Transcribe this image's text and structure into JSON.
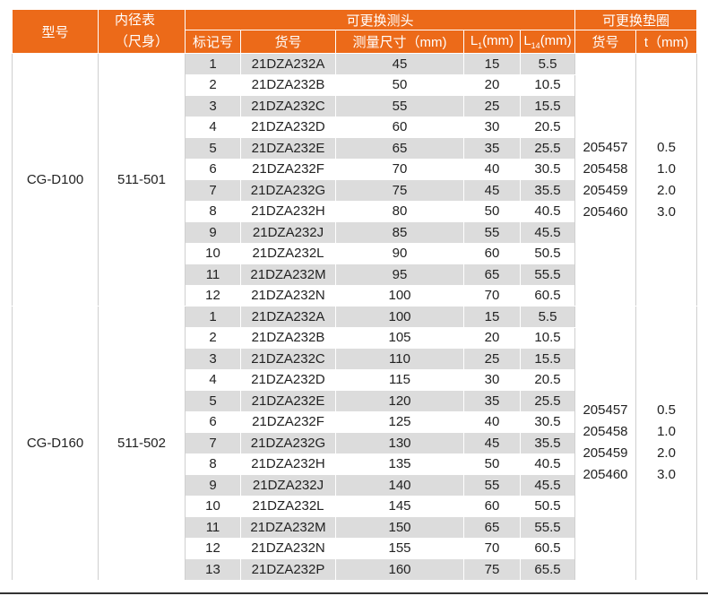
{
  "header": {
    "model": "型号",
    "bore_gauge": "内径表",
    "bore_gauge_sub": "（尺身）",
    "probe_group": "可更换测头",
    "washer_group": "可更换垫圈",
    "mark_no": "标记号",
    "part_no": "货号",
    "range": "测量尺寸（mm)",
    "l1_prefix": "L",
    "l1_sub": "1",
    "l1_suffix": "(mm)",
    "l14_prefix": "L",
    "l14_sub": "14",
    "l14_suffix": "(mm)",
    "washer_part_no": "货号",
    "washer_t": "t（mm)"
  },
  "groups": [
    {
      "model": "CG-D100",
      "bore_gauge": "511-501",
      "washer_codes": [
        "205457",
        "205458",
        "205459",
        "205460"
      ],
      "washer_ts": [
        "0.5",
        "1.0",
        "2.0",
        "3.0"
      ],
      "rows": [
        {
          "mark": "1",
          "part": "21DZA232A",
          "range": "45",
          "l1": "15",
          "l14": "5.5"
        },
        {
          "mark": "2",
          "part": "21DZA232B",
          "range": "50",
          "l1": "20",
          "l14": "10.5"
        },
        {
          "mark": "3",
          "part": "21DZA232C",
          "range": "55",
          "l1": "25",
          "l14": "15.5"
        },
        {
          "mark": "4",
          "part": "21DZA232D",
          "range": "60",
          "l1": "30",
          "l14": "20.5"
        },
        {
          "mark": "5",
          "part": "21DZA232E",
          "range": "65",
          "l1": "35",
          "l14": "25.5"
        },
        {
          "mark": "6",
          "part": "21DZA232F",
          "range": "70",
          "l1": "40",
          "l14": "30.5"
        },
        {
          "mark": "7",
          "part": "21DZA232G",
          "range": "75",
          "l1": "45",
          "l14": "35.5"
        },
        {
          "mark": "8",
          "part": "21DZA232H",
          "range": "80",
          "l1": "50",
          "l14": "40.5"
        },
        {
          "mark": "9",
          "part": "21DZA232J",
          "range": "85",
          "l1": "55",
          "l14": "45.5"
        },
        {
          "mark": "10",
          "part": "21DZA232L",
          "range": "90",
          "l1": "60",
          "l14": "50.5"
        },
        {
          "mark": "11",
          "part": "21DZA232M",
          "range": "95",
          "l1": "65",
          "l14": "55.5"
        },
        {
          "mark": "12",
          "part": "21DZA232N",
          "range": "100",
          "l1": "70",
          "l14": "60.5"
        }
      ]
    },
    {
      "model": "CG-D160",
      "bore_gauge": "511-502",
      "washer_codes": [
        "205457",
        "205458",
        "205459",
        "205460"
      ],
      "washer_ts": [
        "0.5",
        "1.0",
        "2.0",
        "3.0"
      ],
      "rows": [
        {
          "mark": "1",
          "part": "21DZA232A",
          "range": "100",
          "l1": "15",
          "l14": "5.5"
        },
        {
          "mark": "2",
          "part": "21DZA232B",
          "range": "105",
          "l1": "20",
          "l14": "10.5"
        },
        {
          "mark": "3",
          "part": "21DZA232C",
          "range": "110",
          "l1": "25",
          "l14": "15.5"
        },
        {
          "mark": "4",
          "part": "21DZA232D",
          "range": "115",
          "l1": "30",
          "l14": "20.5"
        },
        {
          "mark": "5",
          "part": "21DZA232E",
          "range": "120",
          "l1": "35",
          "l14": "25.5"
        },
        {
          "mark": "6",
          "part": "21DZA232F",
          "range": "125",
          "l1": "40",
          "l14": "30.5"
        },
        {
          "mark": "7",
          "part": "21DZA232G",
          "range": "130",
          "l1": "45",
          "l14": "35.5"
        },
        {
          "mark": "8",
          "part": "21DZA232H",
          "range": "135",
          "l1": "50",
          "l14": "40.5"
        },
        {
          "mark": "9",
          "part": "21DZA232J",
          "range": "140",
          "l1": "55",
          "l14": "45.5"
        },
        {
          "mark": "10",
          "part": "21DZA232L",
          "range": "145",
          "l1": "60",
          "l14": "50.5"
        },
        {
          "mark": "11",
          "part": "21DZA232M",
          "range": "150",
          "l1": "65",
          "l14": "55.5"
        },
        {
          "mark": "12",
          "part": "21DZA232N",
          "range": "155",
          "l1": "70",
          "l14": "60.5"
        },
        {
          "mark": "13",
          "part": "21DZA232P",
          "range": "160",
          "l1": "75",
          "l14": "65.5"
        }
      ]
    }
  ],
  "colors": {
    "header_bg": "#ec6a19",
    "row_shade": "#dcdcdc"
  }
}
